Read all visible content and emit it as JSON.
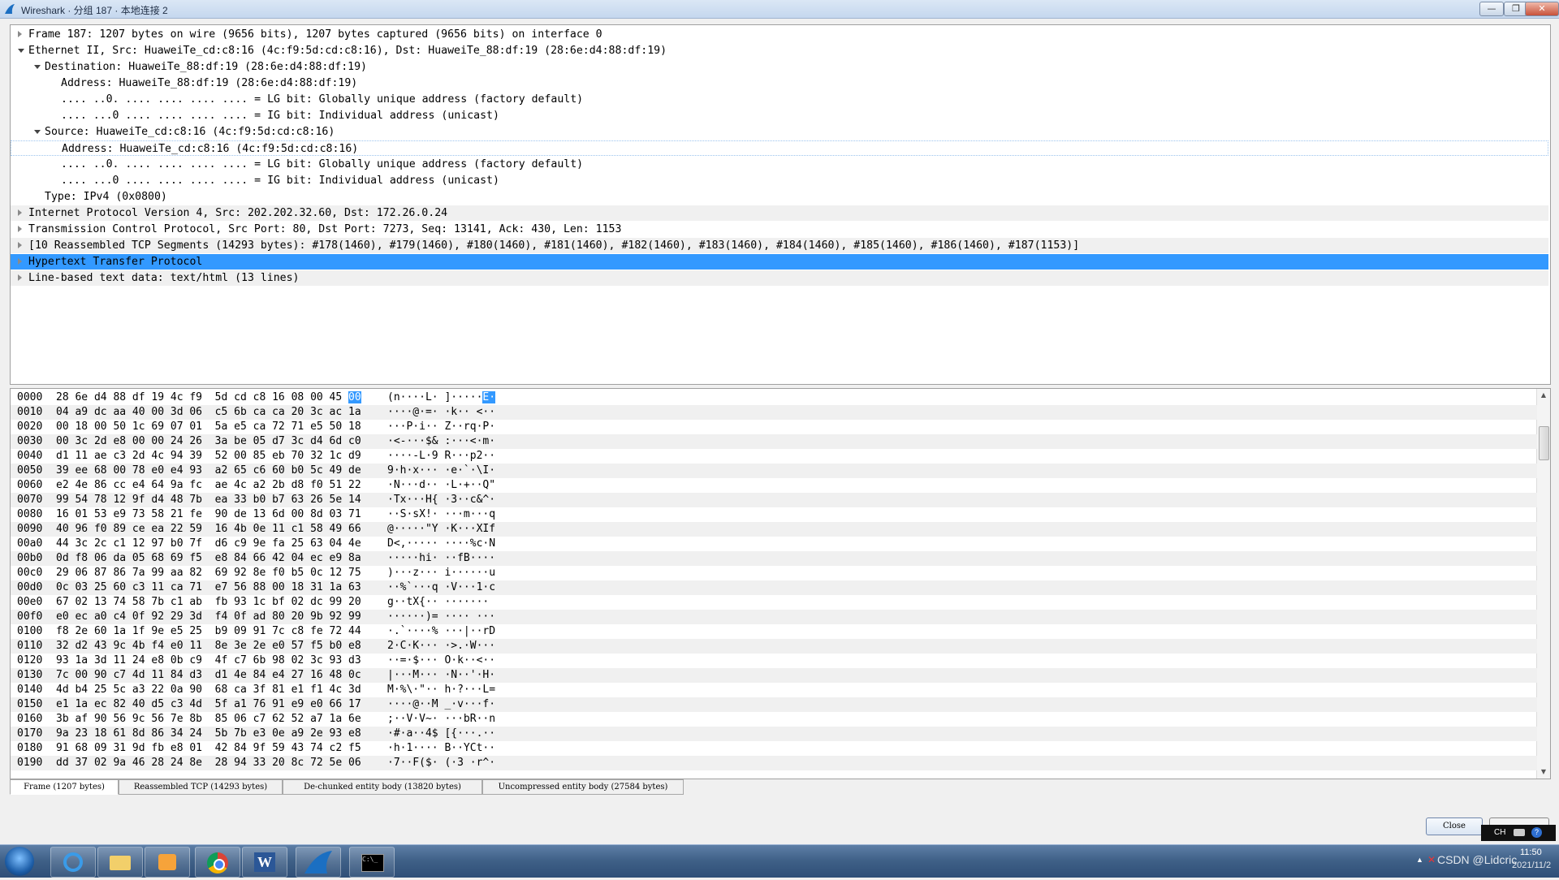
{
  "window": {
    "title": "Wireshark · 分组 187 · 本地连接 2",
    "min_label": "—",
    "max_label": "❐",
    "close_label": "✕"
  },
  "detail_rows": [
    {
      "indent": 0,
      "toggle": "collapsed",
      "text": "Frame 187: 1207 bytes on wire (9656 bits), 1207 bytes captured (9656 bits) on interface 0",
      "style": ""
    },
    {
      "indent": 0,
      "toggle": "expanded",
      "text": "Ethernet II, Src: HuaweiTe_cd:c8:16 (4c:f9:5d:cd:c8:16), Dst: HuaweiTe_88:df:19 (28:6e:d4:88:df:19)",
      "style": ""
    },
    {
      "indent": 1,
      "toggle": "expanded",
      "text": "Destination: HuaweiTe_88:df:19 (28:6e:d4:88:df:19)",
      "style": ""
    },
    {
      "indent": 2,
      "toggle": "",
      "text": "Address: HuaweiTe_88:df:19 (28:6e:d4:88:df:19)",
      "style": ""
    },
    {
      "indent": 2,
      "toggle": "",
      "text": ".... ..0. .... .... .... .... = LG bit: Globally unique address (factory default)",
      "style": ""
    },
    {
      "indent": 2,
      "toggle": "",
      "text": ".... ...0 .... .... .... .... = IG bit: Individual address (unicast)",
      "style": ""
    },
    {
      "indent": 1,
      "toggle": "expanded",
      "text": "Source: HuaweiTe_cd:c8:16 (4c:f9:5d:cd:c8:16)",
      "style": ""
    },
    {
      "indent": 2,
      "toggle": "",
      "text": "Address: HuaweiTe_cd:c8:16 (4c:f9:5d:cd:c8:16)",
      "style": "boxed"
    },
    {
      "indent": 2,
      "toggle": "",
      "text": ".... ..0. .... .... .... .... = LG bit: Globally unique address (factory default)",
      "style": ""
    },
    {
      "indent": 2,
      "toggle": "",
      "text": ".... ...0 .... .... .... .... = IG bit: Individual address (unicast)",
      "style": ""
    },
    {
      "indent": 1,
      "toggle": "",
      "text": "Type: IPv4 (0x0800)",
      "style": ""
    },
    {
      "indent": 0,
      "toggle": "collapsed",
      "text": "Internet Protocol Version 4, Src: 202.202.32.60, Dst: 172.26.0.24",
      "style": "shade"
    },
    {
      "indent": 0,
      "toggle": "collapsed",
      "text": "Transmission Control Protocol, Src Port: 80, Dst Port: 7273, Seq: 13141, Ack: 430, Len: 1153",
      "style": ""
    },
    {
      "indent": 0,
      "toggle": "collapsed",
      "text": "[10 Reassembled TCP Segments (14293 bytes): #178(1460), #179(1460), #180(1460), #181(1460), #182(1460), #183(1460), #184(1460), #185(1460), #186(1460), #187(1153)]",
      "style": "shade"
    },
    {
      "indent": 0,
      "toggle": "collapsed",
      "text": "Hypertext Transfer Protocol",
      "style": "hl"
    },
    {
      "indent": 0,
      "toggle": "collapsed",
      "text": "Line-based text data: text/html (13 lines)",
      "style": "shade"
    }
  ],
  "hex_rows": [
    {
      "off": "0000",
      "bytes": "28 6e d4 88 df 19 4c f9  5d cd c8 16 08 00 45 ",
      "sel_byte": "00",
      "ascii": "(n····L· ]·····",
      "sel_ascii": "E·"
    },
    {
      "off": "0010",
      "bytes": "04 a9 dc aa 40 00 3d 06  c5 6b ca ca 20 3c ac 1a",
      "ascii": "····@·=· ·k·· <··"
    },
    {
      "off": "0020",
      "bytes": "00 18 00 50 1c 69 07 01  5a e5 ca 72 71 e5 50 18",
      "ascii": "···P·i·· Z··rq·P·"
    },
    {
      "off": "0030",
      "bytes": "00 3c 2d e8 00 00 24 26  3a be 05 d7 3c d4 6d c0",
      "ascii": "·<-···$& :···<·m·"
    },
    {
      "off": "0040",
      "bytes": "d1 11 ae c3 2d 4c 94 39  52 00 85 eb 70 32 1c d9",
      "ascii": "····-L·9 R···p2··"
    },
    {
      "off": "0050",
      "bytes": "39 ee 68 00 78 e0 e4 93  a2 65 c6 60 b0 5c 49 de",
      "ascii": "9·h·x··· ·e·`·\\I·"
    },
    {
      "off": "0060",
      "bytes": "e2 4e 86 cc e4 64 9a fc  ae 4c a2 2b d8 f0 51 22",
      "ascii": "·N···d·· ·L·+··Q\""
    },
    {
      "off": "0070",
      "bytes": "99 54 78 12 9f d4 48 7b  ea 33 b0 b7 63 26 5e 14",
      "ascii": "·Tx···H{ ·3··c&^·"
    },
    {
      "off": "0080",
      "bytes": "16 01 53 e9 73 58 21 fe  90 de 13 6d 00 8d 03 71",
      "ascii": "··S·sX!· ···m···q"
    },
    {
      "off": "0090",
      "bytes": "40 96 f0 89 ce ea 22 59  16 4b 0e 11 c1 58 49 66",
      "ascii": "@·····\"Y ·K···XIf"
    },
    {
      "off": "00a0",
      "bytes": "44 3c 2c c1 12 97 b0 7f  d6 c9 9e fa 25 63 04 4e",
      "ascii": "D<,····· ····%c·N"
    },
    {
      "off": "00b0",
      "bytes": "0d f8 06 da 05 68 69 f5  e8 84 66 42 04 ec e9 8a",
      "ascii": "·····hi· ··fB····"
    },
    {
      "off": "00c0",
      "bytes": "29 06 87 86 7a 99 aa 82  69 92 8e f0 b5 0c 12 75",
      "ascii": ")···z··· i······u"
    },
    {
      "off": "00d0",
      "bytes": "0c 03 25 60 c3 11 ca 71  e7 56 88 00 18 31 1a 63",
      "ascii": "··%`···q ·V···1·c"
    },
    {
      "off": "00e0",
      "bytes": "67 02 13 74 58 7b c1 ab  fb 93 1c bf 02 dc 99 20",
      "ascii": "g··tX{·· ······· "
    },
    {
      "off": "00f0",
      "bytes": "e0 ec a0 c4 0f 92 29 3d  f4 0f ad 80 20 9b 92 99",
      "ascii": "······)= ···· ···"
    },
    {
      "off": "0100",
      "bytes": "f8 2e 60 1a 1f 9e e5 25  b9 09 91 7c c8 fe 72 44",
      "ascii": "·.`····% ···|··rD"
    },
    {
      "off": "0110",
      "bytes": "32 d2 43 9c 4b f4 e0 11  8e 3e 2e e0 57 f5 b0 e8",
      "ascii": "2·C·K··· ·>.·W···"
    },
    {
      "off": "0120",
      "bytes": "93 1a 3d 11 24 e8 0b c9  4f c7 6b 98 02 3c 93 d3",
      "ascii": "··=·$··· O·k··<··"
    },
    {
      "off": "0130",
      "bytes": "7c 00 90 c7 4d 11 84 d3  d1 4e 84 e4 27 16 48 0c",
      "ascii": "|···M··· ·N··'·H·"
    },
    {
      "off": "0140",
      "bytes": "4d b4 25 5c a3 22 0a 90  68 ca 3f 81 e1 f1 4c 3d",
      "ascii": "M·%\\·\"·· h·?···L="
    },
    {
      "off": "0150",
      "bytes": "e1 1a ec 82 40 d5 c3 4d  5f a1 76 91 e9 e0 66 17",
      "ascii": "····@··M _·v···f·"
    },
    {
      "off": "0160",
      "bytes": "3b af 90 56 9c 56 7e 8b  85 06 c7 62 52 a7 1a 6e",
      "ascii": ";··V·V~· ···bR··n"
    },
    {
      "off": "0170",
      "bytes": "9a 23 18 61 8d 86 34 24  5b 7b e3 0e a9 2e 93 e8",
      "ascii": "·#·a··4$ [{···.··"
    },
    {
      "off": "0180",
      "bytes": "91 68 09 31 9d fb e8 01  42 84 9f 59 43 74 c2 f5",
      "ascii": "·h·1···· B··YCt··"
    },
    {
      "off": "0190",
      "bytes": "dd 37 02 9a 46 28 24 8e  28 94 33 20 8c 72 5e 06",
      "ascii": "·7··F($· (·3 ·r^·"
    }
  ],
  "tabs": [
    {
      "label": "Frame (1207 bytes)",
      "active": true
    },
    {
      "label": "Reassembled TCP (14293 bytes)",
      "active": false
    },
    {
      "label": "De-chunked entity body (13820 bytes)",
      "active": false
    },
    {
      "label": "Uncompressed entity body (27584 bytes)",
      "active": false
    }
  ],
  "buttons": {
    "close": "Close"
  },
  "taskbar": {
    "apps": [
      "start-orb",
      "internet-explorer",
      "file-explorer",
      "media-player",
      "chrome",
      "word",
      "wireshark",
      "command-prompt"
    ],
    "ime": "CH",
    "clock_time": "11:50",
    "clock_date": "2021/11/2",
    "watermark": "CSDN @Lidcric"
  },
  "colors": {
    "selection": "#3399ff",
    "row_shade": "#f0f0f0"
  }
}
